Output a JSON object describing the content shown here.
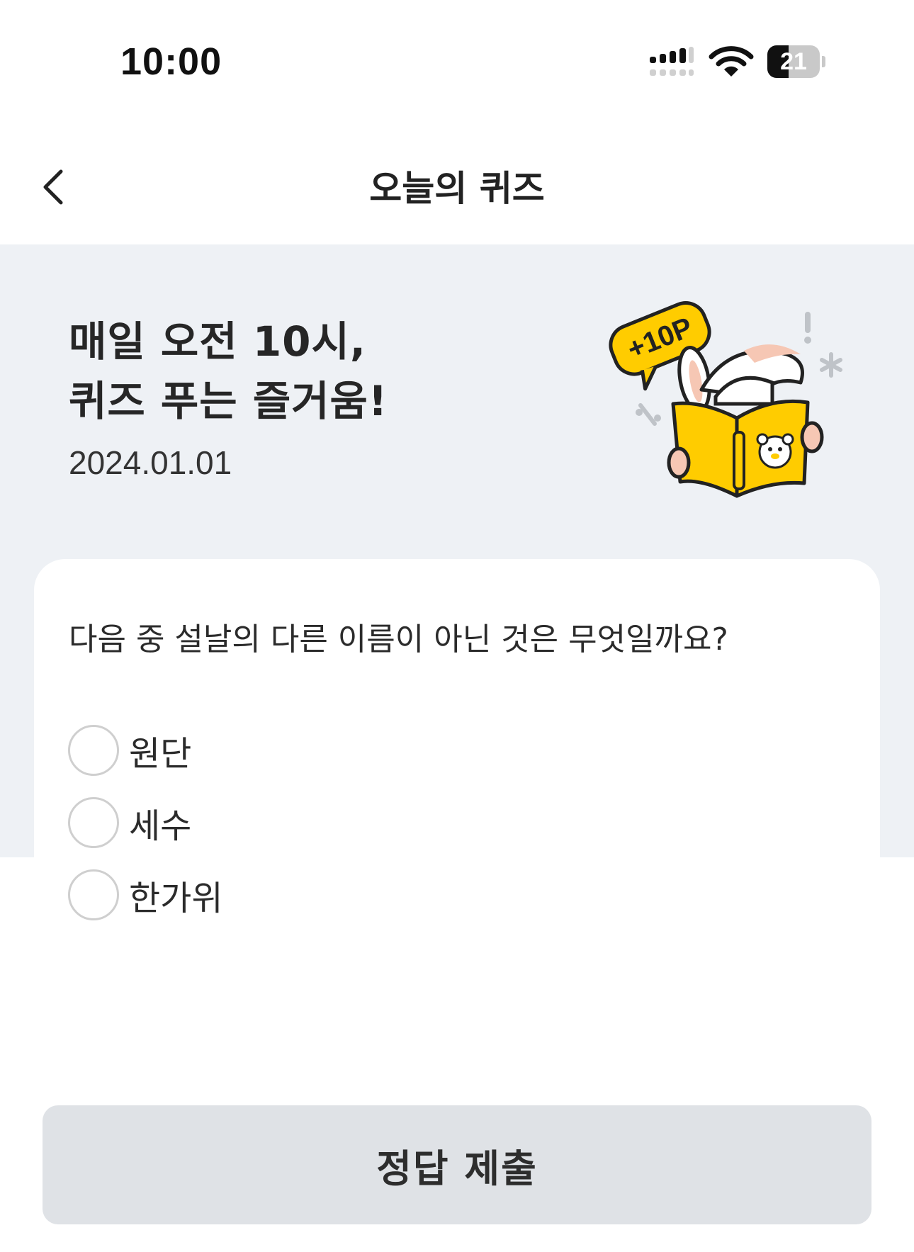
{
  "status_bar": {
    "time": "10:00",
    "signal_icon": "cellular-signal-icon",
    "wifi_icon": "wifi-icon",
    "battery_level": "21",
    "battery_percent": 21
  },
  "nav": {
    "back_icon": "chevron-left-icon",
    "title": "오늘의 퀴즈"
  },
  "banner": {
    "headline_line1": "매일 오전 10시,",
    "headline_line2": "퀴즈 푸는 즐거움!",
    "date": "2024.01.01",
    "illustration": {
      "badge_text": "+10P",
      "badge_color": "#FFCC00",
      "book_color": "#FFCC00"
    }
  },
  "quiz": {
    "question": "다음 중 설날의 다른 이름이 아닌 것은 무엇일까요?",
    "options": [
      {
        "label": "원단",
        "selected": false
      },
      {
        "label": "세수",
        "selected": false
      },
      {
        "label": "한가위",
        "selected": false
      }
    ]
  },
  "submit": {
    "label": "정답 제출",
    "background": "#DFE2E6"
  },
  "colors": {
    "banner_bg": "#EEF1F5",
    "radio_border": "#CFCFCF"
  }
}
